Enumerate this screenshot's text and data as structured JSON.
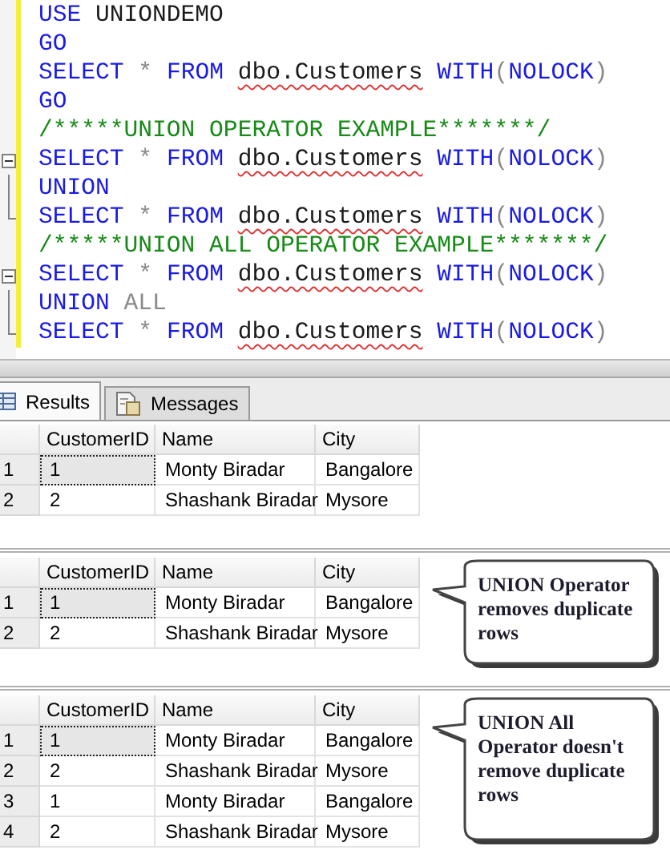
{
  "editor": {
    "lines": [
      {
        "kind": "plain",
        "tokens": [
          {
            "kind": "keyword",
            "text": "USE"
          },
          {
            "kind": "identifier",
            "text": " UNIONDEMO"
          }
        ]
      },
      {
        "kind": "plain",
        "tokens": [
          {
            "kind": "keyword",
            "text": "GO"
          }
        ]
      },
      {
        "kind": "plain",
        "tokens": [
          {
            "kind": "keyword",
            "text": "SELECT "
          },
          {
            "kind": "operator",
            "text": "* "
          },
          {
            "kind": "keyword",
            "text": "FROM "
          },
          {
            "kind": "object",
            "text": "dbo.Customers"
          },
          {
            "kind": "keyword",
            "text": " WITH"
          },
          {
            "kind": "operator",
            "text": "("
          },
          {
            "kind": "keyword",
            "text": "NOLOCK"
          },
          {
            "kind": "operator",
            "text": ")"
          }
        ]
      },
      {
        "kind": "plain",
        "tokens": [
          {
            "kind": "keyword",
            "text": "GO"
          }
        ]
      },
      {
        "kind": "plain",
        "tokens": [
          {
            "kind": "comment",
            "text": "/*****UNION OPERATOR EXAMPLE*******/"
          }
        ]
      },
      {
        "kind": "fold_start",
        "tokens": [
          {
            "kind": "keyword",
            "text": "SELECT "
          },
          {
            "kind": "operator",
            "text": "* "
          },
          {
            "kind": "keyword",
            "text": "FROM "
          },
          {
            "kind": "object",
            "text": "dbo.Customers"
          },
          {
            "kind": "keyword",
            "text": " WITH"
          },
          {
            "kind": "operator",
            "text": "("
          },
          {
            "kind": "keyword",
            "text": "NOLOCK"
          },
          {
            "kind": "operator",
            "text": ")"
          }
        ]
      },
      {
        "kind": "fold_body",
        "tokens": [
          {
            "kind": "keyword",
            "text": "UNION"
          }
        ]
      },
      {
        "kind": "fold_end",
        "tokens": [
          {
            "kind": "keyword",
            "text": "SELECT "
          },
          {
            "kind": "operator",
            "text": "* "
          },
          {
            "kind": "keyword",
            "text": "FROM "
          },
          {
            "kind": "object",
            "text": "dbo.Customers"
          },
          {
            "kind": "keyword",
            "text": " WITH"
          },
          {
            "kind": "operator",
            "text": "("
          },
          {
            "kind": "keyword",
            "text": "NOLOCK"
          },
          {
            "kind": "operator",
            "text": ")"
          }
        ]
      },
      {
        "kind": "plain",
        "tokens": [
          {
            "kind": "comment",
            "text": "/*****UNION ALL OPERATOR EXAMPLE*******/"
          }
        ]
      },
      {
        "kind": "fold_start",
        "tokens": [
          {
            "kind": "keyword",
            "text": "SELECT "
          },
          {
            "kind": "operator",
            "text": "* "
          },
          {
            "kind": "keyword",
            "text": "FROM "
          },
          {
            "kind": "object",
            "text": "dbo.Customers"
          },
          {
            "kind": "keyword",
            "text": " WITH"
          },
          {
            "kind": "operator",
            "text": "("
          },
          {
            "kind": "keyword",
            "text": "NOLOCK"
          },
          {
            "kind": "operator",
            "text": ")"
          }
        ]
      },
      {
        "kind": "fold_body",
        "tokens": [
          {
            "kind": "keyword",
            "text": "UNION "
          },
          {
            "kind": "operator",
            "text": "ALL"
          }
        ]
      },
      {
        "kind": "fold_end",
        "tokens": [
          {
            "kind": "keyword",
            "text": "SELECT "
          },
          {
            "kind": "operator",
            "text": "* "
          },
          {
            "kind": "keyword",
            "text": "FROM "
          },
          {
            "kind": "object",
            "text": "dbo.Customers"
          },
          {
            "kind": "keyword",
            "text": " WITH"
          },
          {
            "kind": "operator",
            "text": "("
          },
          {
            "kind": "keyword",
            "text": "NOLOCK"
          },
          {
            "kind": "operator",
            "text": ")"
          }
        ]
      }
    ]
  },
  "tabs": [
    {
      "label": "Results",
      "kind": "grid",
      "selected": true
    },
    {
      "label": "Messages",
      "kind": "messages",
      "selected": false
    }
  ],
  "grids": [
    {
      "columns": [
        "CustomerID",
        "Name",
        "City"
      ],
      "rows": [
        {
          "number": "1",
          "focused": true,
          "cells": [
            "1",
            "Monty Biradar",
            "Bangalore"
          ]
        },
        {
          "number": "2",
          "focused": false,
          "cells": [
            "2",
            "Shashank Biradar",
            "Mysore"
          ]
        }
      ]
    },
    {
      "columns": [
        "CustomerID",
        "Name",
        "City"
      ],
      "callout": "UNION Operator removes duplicate rows",
      "rows": [
        {
          "number": "1",
          "focused": true,
          "cells": [
            "1",
            "Monty Biradar",
            "Bangalore"
          ]
        },
        {
          "number": "2",
          "focused": false,
          "cells": [
            "2",
            "Shashank Biradar",
            "Mysore"
          ]
        }
      ]
    },
    {
      "columns": [
        "CustomerID",
        "Name",
        "City"
      ],
      "callout": "UNION All Operator doesn't remove duplicate rows",
      "rows": [
        {
          "number": "1",
          "focused": true,
          "cells": [
            "1",
            "Monty Biradar",
            "Bangalore"
          ]
        },
        {
          "number": "2",
          "focused": false,
          "cells": [
            "2",
            "Shashank Biradar",
            "Mysore"
          ]
        },
        {
          "number": "3",
          "focused": false,
          "cells": [
            "1",
            "Monty Biradar",
            "Bangalore"
          ]
        },
        {
          "number": "4",
          "focused": false,
          "cells": [
            "2",
            "Shashank Biradar",
            "Mysore"
          ]
        }
      ]
    }
  ]
}
